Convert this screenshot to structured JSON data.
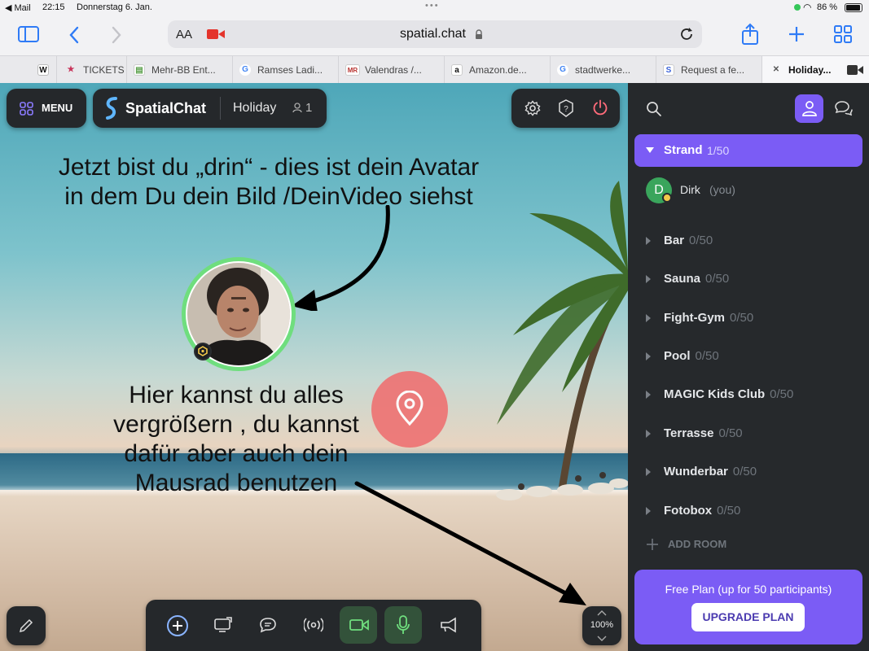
{
  "status_bar": {
    "back_app": "◀ Mail",
    "time": "22:15",
    "date": "Donnerstag 6. Jan.",
    "battery": "86 %"
  },
  "browser": {
    "text_size": "AA",
    "url": "spatial.chat",
    "tabs": [
      {
        "favicon": "W",
        "label": ""
      },
      {
        "favicon": "★",
        "label": "TICKETS"
      },
      {
        "favicon": "▤",
        "label": "Mehr-BB Ent..."
      },
      {
        "favicon": "G",
        "label": "Ramses Ladi..."
      },
      {
        "favicon": "MR",
        "label": "Valendras /..."
      },
      {
        "favicon": "a",
        "label": "Amazon.de..."
      },
      {
        "favicon": "G",
        "label": "stadtwerke..."
      },
      {
        "favicon": "S",
        "label": "Request a fe..."
      },
      {
        "favicon": "✕",
        "label": "Holiday..."
      }
    ]
  },
  "app": {
    "menu_label": "MENU",
    "brand": "SpatialChat",
    "space_name": "Holiday",
    "participant_count": "1",
    "zoom": "100%"
  },
  "annotations": {
    "avatar_line1": "Jetzt bist du „drin“ - dies ist dein Avatar",
    "avatar_line2": "in dem Du dein Bild /DeinVideo siehst",
    "zoom_line1": "Hier kannst du alles",
    "zoom_line2": "vergrößern , du kannst",
    "zoom_line3": "dafür aber auch dein",
    "zoom_line4": "Mausrad benutzen"
  },
  "sidebar": {
    "active_room": {
      "name": "Strand",
      "count": "1/50"
    },
    "user": {
      "initial": "D",
      "name": "Dirk",
      "tag": "(you)"
    },
    "rooms": [
      {
        "name": "Bar",
        "count": "0/50"
      },
      {
        "name": "Sauna",
        "count": "0/50"
      },
      {
        "name": "Fight-Gym",
        "count": "0/50"
      },
      {
        "name": "Pool",
        "count": "0/50"
      },
      {
        "name": "MAGIC Kids Club",
        "count": "0/50"
      },
      {
        "name": "Terrasse",
        "count": "0/50"
      },
      {
        "name": "Wunderbar",
        "count": "0/50"
      },
      {
        "name": "Fotobox",
        "count": "0/50"
      }
    ],
    "add_room": "ADD ROOM",
    "plan_text": "Free Plan (up for 50 participants)",
    "upgrade_label": "UPGRADE PLAN"
  },
  "colors": {
    "accent": "#7b5cf5",
    "panel": "#25282b",
    "avatar_ring": "#6fde7e",
    "location_pin": "#ee7474",
    "safari_blue": "#2f7bf6"
  }
}
